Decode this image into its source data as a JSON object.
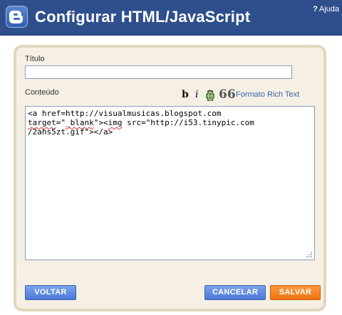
{
  "header": {
    "title": "Configurar HTML/JavaScript",
    "help_label": "Ajuda",
    "help_symbol": "?",
    "background_color": "#2e4f8c",
    "logo_icon": "blogger-logo-icon"
  },
  "form": {
    "title_label": "Título",
    "title_value": "",
    "content_label": "Conteúdo",
    "toolbar": {
      "bold_symbol": "b",
      "italic_symbol": "i",
      "link_icon": "link-icon",
      "quote_symbol": "66",
      "rich_text_label": "Formato Rich Text"
    },
    "content_value": "<a href=http://visualmusicas.blogspot.com\ntarget=\"_blank\"><img src=\"http://i53.tinypic.com\n/2ahs5zt.gif\"></a>"
  },
  "buttons": {
    "back_label": "VOLTAR",
    "cancel_label": "CANCELAR",
    "save_label": "SALVAR",
    "blue_color": "#5a86df",
    "orange_color": "#f5861f"
  },
  "panel": {
    "background_color": "#f6f0e4",
    "border_color": "#e2d6bd"
  }
}
